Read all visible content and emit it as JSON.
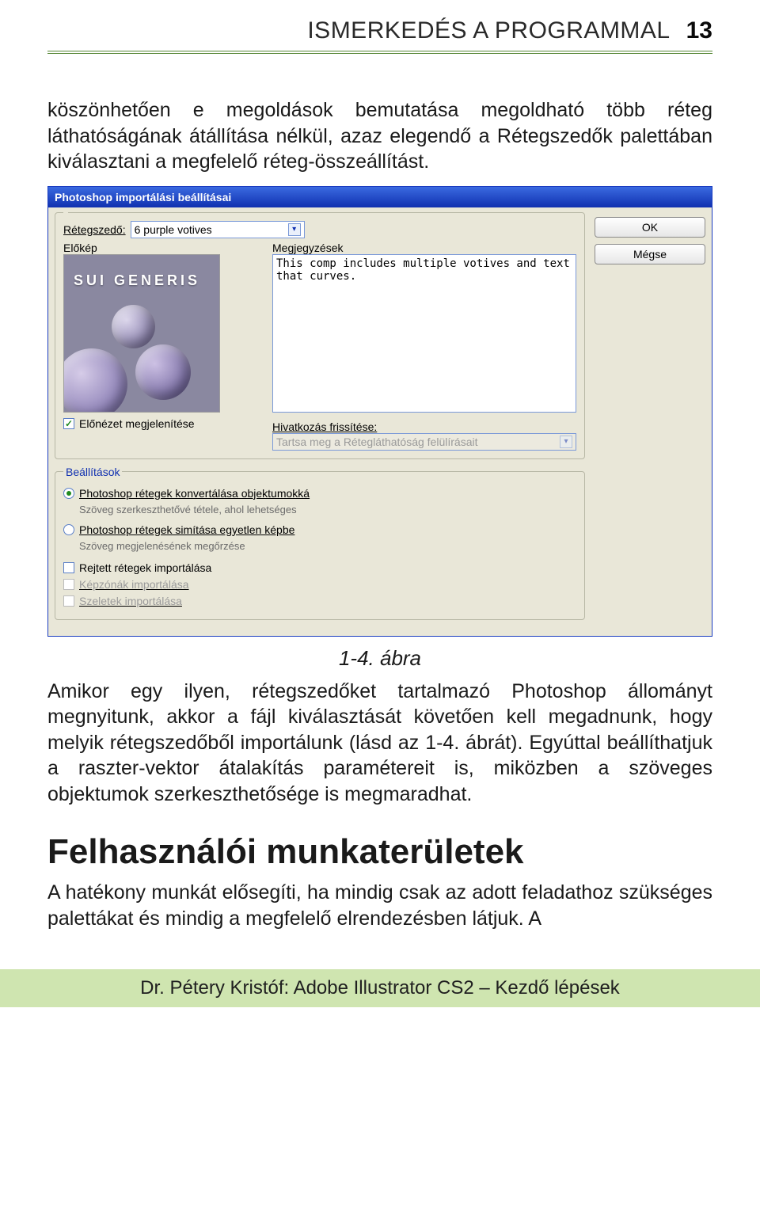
{
  "header": {
    "running_title": "ISMERKEDÉS A PROGRAMMAL",
    "page_number": "13"
  },
  "paragraph1": "köszönhetően e megoldások bemutatása megoldható több réteg láthatóságának átállítása nélkül, azaz elegendő a Rétegszedők palettában kiválasztani a megfelelő réteg-összeállítást.",
  "dialog": {
    "title": "Photoshop importálási beállításai",
    "group1_legend": "",
    "layercomp_label": "Rétegszedő:",
    "layercomp_value": "6 purple votives",
    "preview_label": "Előkép",
    "notes_label": "Megjegyzések",
    "notes_text": "This comp includes multiple votives and text that curves.",
    "sui_text": "SUI GENERIS",
    "show_preview": "Előnézet megjelenítése",
    "link_update_label": "Hivatkozás frissítése:",
    "link_update_value": "Tartsa meg a Rétegláthatóság felülírásait",
    "group2_legend": "Beállítások",
    "opt1": "Photoshop rétegek konvertálása objektumokká",
    "opt1_note": "Szöveg szerkeszthetővé tétele, ahol lehetséges",
    "opt2": "Photoshop rétegek simítása egyetlen képbe",
    "opt2_note": "Szöveg megjelenésének megőrzése",
    "chk_hidden": "Rejtett rétegek importálása",
    "chk_imagemaps": "Képzónák importálása",
    "chk_slices": "Szeletek importálása",
    "btn_ok": "OK",
    "btn_cancel": "Mégse"
  },
  "figure_caption": "1-4. ábra",
  "paragraph2": "Amikor egy ilyen, rétegszedőket tartalmazó Photoshop állományt megnyitunk, akkor a fájl kiválasztását követően kell megadnunk, hogy melyik rétegszedőből importálunk (lásd az 1‑4. ábrát). Egyúttal beállíthatjuk a raszter-vektor átalakítás paramétereit is, miközben a szöveges objektumok szerkeszthetősége is megmaradhat.",
  "section_heading": "Felhasználói munkaterületek",
  "paragraph3": "A hatékony munkát elősegíti, ha mindig csak az adott feladathoz szükséges palettákat és mindig a megfelelő elrendezésben látjuk. A",
  "footer": "Dr. Pétery Kristóf: Adobe Illustrator CS2 – Kezdő lépések"
}
